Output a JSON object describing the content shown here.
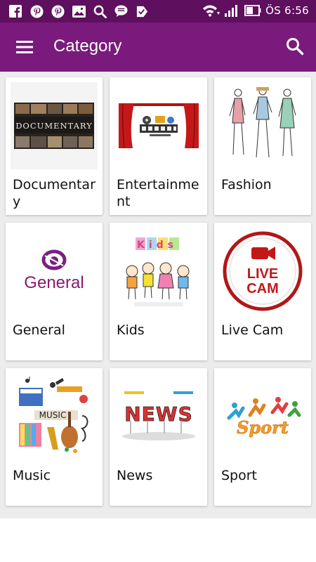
{
  "status_bar": {
    "left_icons": [
      "facebook-icon",
      "pinterest-icon",
      "pinterest-icon",
      "gallery-icon",
      "search-icon",
      "message-icon",
      "task-icon"
    ],
    "right_icons": [
      "wifi-icon",
      "signal-icon",
      "battery-icon"
    ],
    "time": "ÖS 6:56"
  },
  "app_bar": {
    "title": "Category",
    "menu_icon": "hamburger-menu-icon",
    "search_icon": "search-icon",
    "color": "#7a1a7c",
    "status_color": "#5e0f5e"
  },
  "categories": [
    {
      "label": "Documentary"
    },
    {
      "label": "Entertainment"
    },
    {
      "label": "Fashion"
    },
    {
      "label": "General"
    },
    {
      "label": "Kids"
    },
    {
      "label": "Live Cam"
    },
    {
      "label": "Music"
    },
    {
      "label": "News"
    },
    {
      "label": "Sport"
    }
  ],
  "thumbnails": {
    "documentary_text": "DOCUMENTARY",
    "general_text": "General",
    "kids_text": "Kids",
    "livecam_line1": "LIVE",
    "livecam_line2": "CAM",
    "music_text": "MUSIC",
    "news_text": "NEWS",
    "sport_text": "Sport"
  }
}
